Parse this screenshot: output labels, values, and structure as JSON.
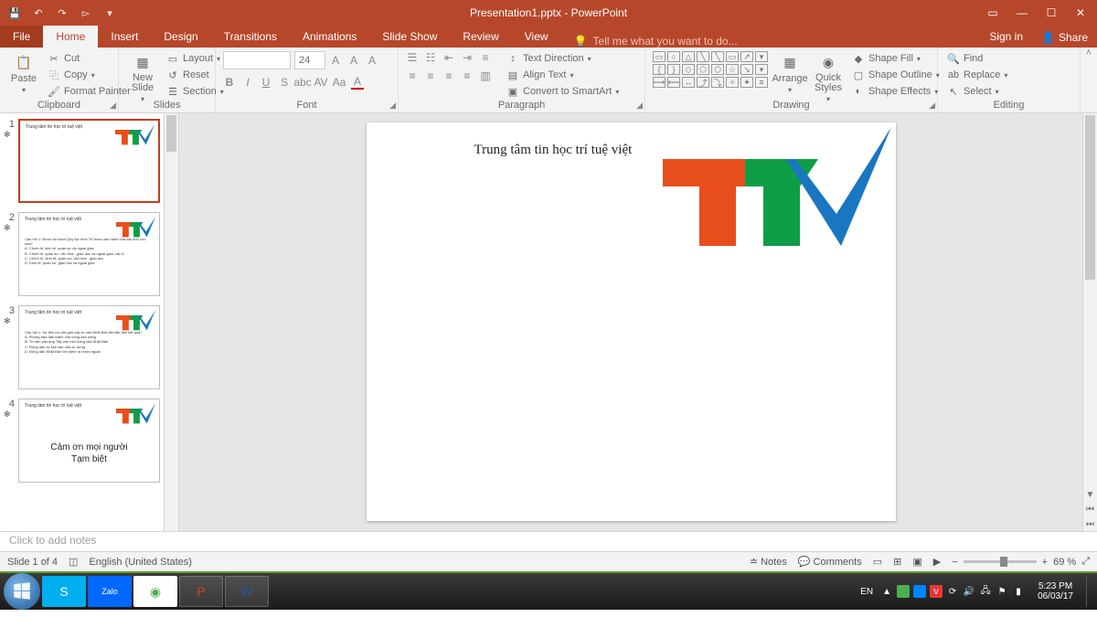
{
  "titlebar": {
    "title": "Presentation1.pptx - PowerPoint"
  },
  "tabs": {
    "file": "File",
    "home": "Home",
    "insert": "Insert",
    "design": "Design",
    "transitions": "Transitions",
    "animations": "Animations",
    "slideshow": "Slide Show",
    "review": "Review",
    "view": "View",
    "tell": "Tell me what you want to do...",
    "signin": "Sign in",
    "share": "Share"
  },
  "ribbon": {
    "clipboard": {
      "label": "Clipboard",
      "paste": "Paste",
      "cut": "Cut",
      "copy": "Copy",
      "fp": "Format Painter"
    },
    "slides": {
      "label": "Slides",
      "new": "New\nSlide",
      "layout": "Layout",
      "reset": "Reset",
      "section": "Section"
    },
    "font": {
      "label": "Font",
      "size": "24"
    },
    "paragraph": {
      "label": "Paragraph",
      "textdir": "Text Direction",
      "align": "Align Text",
      "smart": "Convert to SmartArt"
    },
    "drawing": {
      "label": "Drawing",
      "arrange": "Arrange",
      "quick": "Quick\nStyles",
      "fill": "Shape Fill",
      "outline": "Shape Outline",
      "effects": "Shape Effects"
    },
    "editing": {
      "label": "Editing",
      "find": "Find",
      "replace": "Replace",
      "select": "Select"
    }
  },
  "slides_panel": {
    "slides": [
      {
        "n": "1",
        "mini": "Trung tâm tin học trí tuệ việt",
        "body": "",
        "big": ""
      },
      {
        "n": "2",
        "mini": "Trung tâm tin học trí tuệ việt",
        "body": "Câu hỏi 1: Được sử sách Quý tộc hình Trị được cấu hành của các linh vực nào?\nA. Chính trị, kinh tế, quân sự và ngoại giao\nB. Chính trị, quân sự, văn hóa - giáo dục và ngoại giao, cải trị\nC. Chính trị, kinh tế, quân sự, văn hóa - giáo dục\nD. Kinh tế, quân sự, giáo dục và ngoại giao",
        "big": ""
      },
      {
        "n": "3",
        "mini": "Trung tâm tin học trí tuệ việt",
        "body": "Câu hỏi 1: Sự tiến bộ của giới cấp tư sản Nhật Bản đã dẫn đến kết quả?\nA. Phong trào đấu tranh của nông dân nóng\nB. Tư sản phương Tây cấn một dòng của Nhật Bản\nC. Đông dân tư sản cần văn cư dựng\nD. Đông dân Nhật Bản tìm kiếm ra nước ngoài",
        "big": ""
      },
      {
        "n": "4",
        "mini": "Trung tâm tin học trí tuệ việt",
        "body": "",
        "big": "Cảm ơn mọi người\nTạm biệt"
      }
    ]
  },
  "main_slide": {
    "title": "Trung tâm tin học trí tuệ việt"
  },
  "notes": {
    "placeholder": "Click to add notes"
  },
  "statusbar": {
    "slideinfo": "Slide 1 of 4",
    "lang": "English (United States)",
    "notes": "Notes",
    "comments": "Comments",
    "zoom": "69 %"
  },
  "taskbar": {
    "lang": "EN",
    "time": "5:23 PM",
    "date": "06/03/17"
  }
}
